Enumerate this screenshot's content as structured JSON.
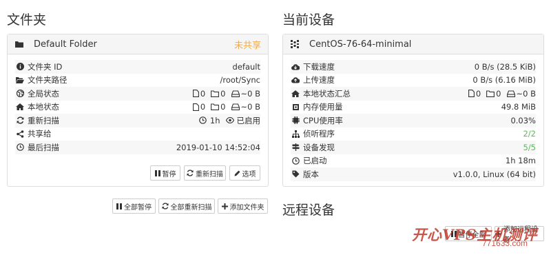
{
  "folders": {
    "section_title": "文件夹",
    "panel": {
      "name": "Default Folder",
      "status": "未共享",
      "rows": [
        {
          "icon": "info-icon",
          "label": "文件夹 ID",
          "value": "default"
        },
        {
          "icon": "folder-open-icon",
          "label": "文件夹路径",
          "value": "/root/Sync"
        },
        {
          "icon": "globe-icon",
          "label": "全局状态",
          "files": "0",
          "dirs": "0",
          "size": "~0 B"
        },
        {
          "icon": "home-icon",
          "label": "本地状态",
          "files": "0",
          "dirs": "0",
          "size": "~0 B"
        },
        {
          "icon": "refresh-icon",
          "label": "重新扫描",
          "interval": "1h",
          "watch": "已启用"
        },
        {
          "icon": "share-icon",
          "label": "共享给",
          "value": ""
        },
        {
          "icon": "clock-icon",
          "label": "最后扫描",
          "value": "2019-01-10 14:52:04"
        }
      ],
      "buttons": {
        "pause": "暂停",
        "rescan": "重新扫描",
        "options": "选项"
      }
    },
    "actions": {
      "pause_all": "全部暂停",
      "rescan_all": "全部重新扫描",
      "add_folder": "添加文件夹"
    }
  },
  "device": {
    "section_title": "当前设备",
    "panel": {
      "name": "CentOS-76-64-minimal",
      "rows": [
        {
          "icon": "cloud-download-icon",
          "label": "下载速度",
          "value": "0 B/s (28.5 KiB)"
        },
        {
          "icon": "cloud-upload-icon",
          "label": "上传速度",
          "value": "0 B/s (6.16 MiB)"
        },
        {
          "icon": "home-icon",
          "label": "本地状态汇总",
          "files": "0",
          "dirs": "0",
          "size": "~0 B"
        },
        {
          "icon": "memory-icon",
          "label": "内存使用量",
          "value": "49.8 MiB"
        },
        {
          "icon": "cpu-icon",
          "label": "CPU使用率",
          "value": "0.03%"
        },
        {
          "icon": "sitemap-icon",
          "label": "侦听程序",
          "value": "2/2",
          "color": "#5cb85c"
        },
        {
          "icon": "signpost-icon",
          "label": "设备发现",
          "value": "5/5",
          "color": "#5cb85c"
        },
        {
          "icon": "clock-icon",
          "label": "已启动",
          "value": "1h 18m"
        },
        {
          "icon": "tag-icon",
          "label": "版本",
          "value": "v1.0.0, Linux (64 bit)"
        }
      ]
    }
  },
  "remote": {
    "section_title": "远程设备",
    "actions": {
      "pause_all": "暂停全部",
      "add_device": "添加远程设备"
    }
  },
  "watermark": {
    "line1": "开心VPS主机测评",
    "line2": "771633.com"
  }
}
